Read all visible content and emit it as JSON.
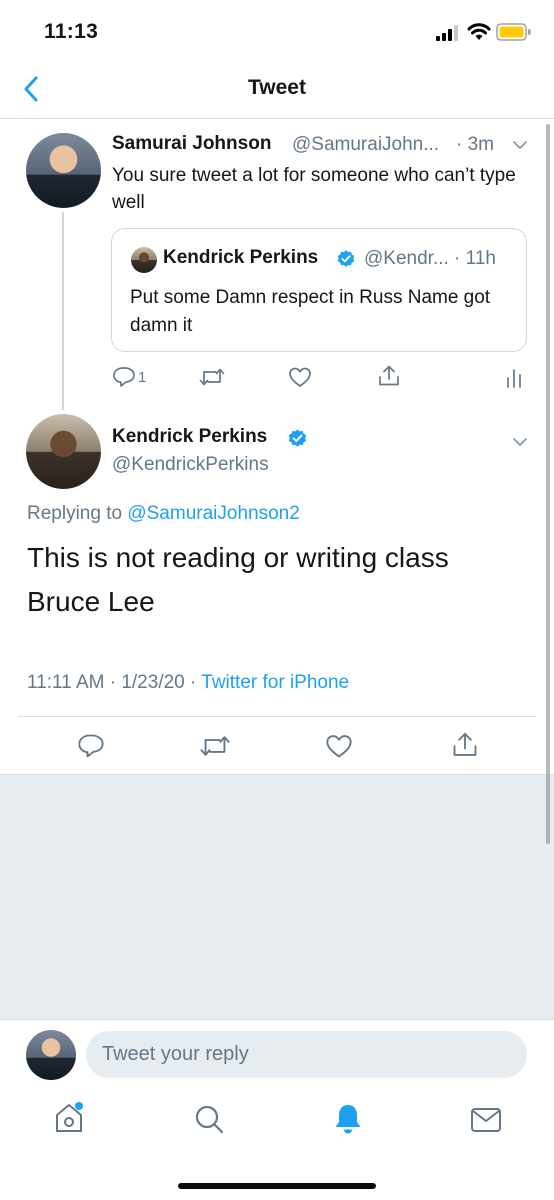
{
  "status_bar": {
    "time": "11:13"
  },
  "nav": {
    "title": "Tweet"
  },
  "quoting_tweet": {
    "name": "Samurai Johnson",
    "handle": "@SamuraiJohn...",
    "time": "· 3m",
    "text": "You sure tweet a lot for someone who can’t type well",
    "quoted": {
      "name": "Kendrick Perkins",
      "handle": "@Kendr... · 11h",
      "text": "Put some Damn respect in Russ Name got damn it"
    },
    "reply_count": "1"
  },
  "main_tweet": {
    "name": "Kendrick Perkins",
    "handle": "@KendrickPerkins",
    "replying_prefix": "Replying to",
    "replying_to": "@SamuraiJohnson2",
    "text": "This is not reading or writing class Bruce Lee",
    "timestamp": "11:11 AM · 1/23/20 · ",
    "source": "Twitter for iPhone"
  },
  "reply_box": {
    "placeholder": "Tweet your reply"
  },
  "colors": {
    "accent": "#1da1f2",
    "muted": "#657786",
    "text": "#14171a",
    "battery": "#ffcc00"
  },
  "icons": [
    "back-chevron-icon",
    "chevron-down-icon",
    "verified-badge-icon",
    "reply-icon",
    "retweet-icon",
    "like-icon",
    "share-icon",
    "analytics-icon",
    "home-icon",
    "search-icon",
    "notifications-icon",
    "messages-icon"
  ]
}
